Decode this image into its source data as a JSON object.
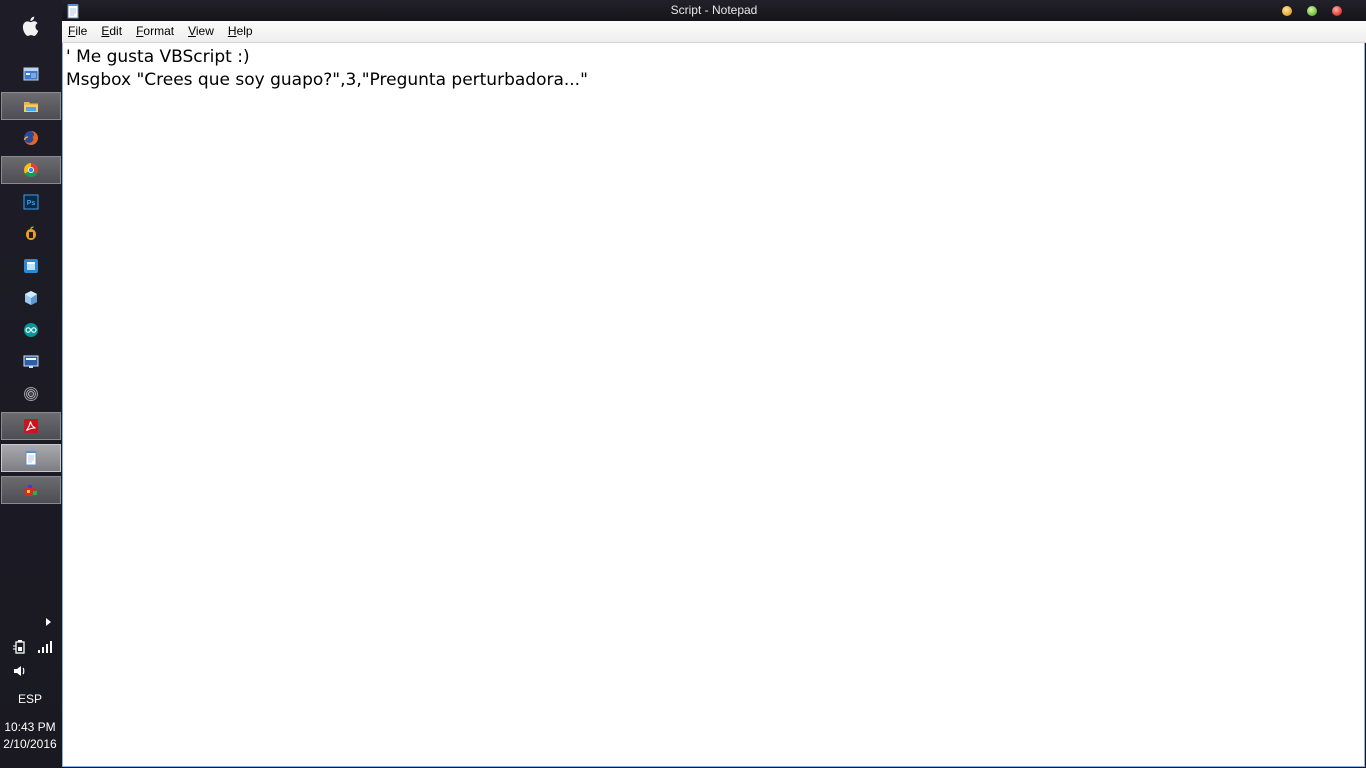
{
  "window": {
    "title": "Script - Notepad"
  },
  "menu": {
    "items": [
      {
        "accel": "F",
        "rest": "ile"
      },
      {
        "accel": "E",
        "rest": "dit"
      },
      {
        "accel": "F",
        "rest": "ormat"
      },
      {
        "accel": "V",
        "rest": "iew"
      },
      {
        "accel": "H",
        "rest": "elp"
      }
    ]
  },
  "editor": {
    "lines": [
      "' Me gusta VBScript :)",
      "Msgbox \"Crees que soy guapo?\",3,\"Pregunta perturbadora...\""
    ]
  },
  "taskbar": {
    "apps": [
      {
        "icon": "desktop-window-icon",
        "state": "normal"
      },
      {
        "icon": "file-explorer-icon",
        "state": "open"
      },
      {
        "icon": "firefox-icon",
        "state": "normal"
      },
      {
        "icon": "chrome-icon",
        "state": "open"
      },
      {
        "icon": "photoshop-icon",
        "state": "normal"
      },
      {
        "icon": "fl-studio-icon",
        "state": "normal"
      },
      {
        "icon": "window-app-icon",
        "state": "normal"
      },
      {
        "icon": "cube-app-icon",
        "state": "normal"
      },
      {
        "icon": "arduino-icon",
        "state": "normal"
      },
      {
        "icon": "monitor-app-icon",
        "state": "normal"
      },
      {
        "icon": "spiral-app-icon",
        "state": "normal"
      },
      {
        "icon": "acrobat-icon",
        "state": "open"
      },
      {
        "icon": "notepad-icon",
        "state": "active"
      },
      {
        "icon": "toolbox-app-icon",
        "state": "open"
      }
    ],
    "photoshop_label": "Ps",
    "language": "ESP",
    "time": "10:43 PM",
    "date": "2/10/2016"
  },
  "colors": {
    "taskbar_bg": "#1b1a22",
    "editor_border": "#8fb0d6",
    "minimize": "#e5a52a",
    "maximize": "#6cbd34",
    "close": "#d8352a"
  }
}
